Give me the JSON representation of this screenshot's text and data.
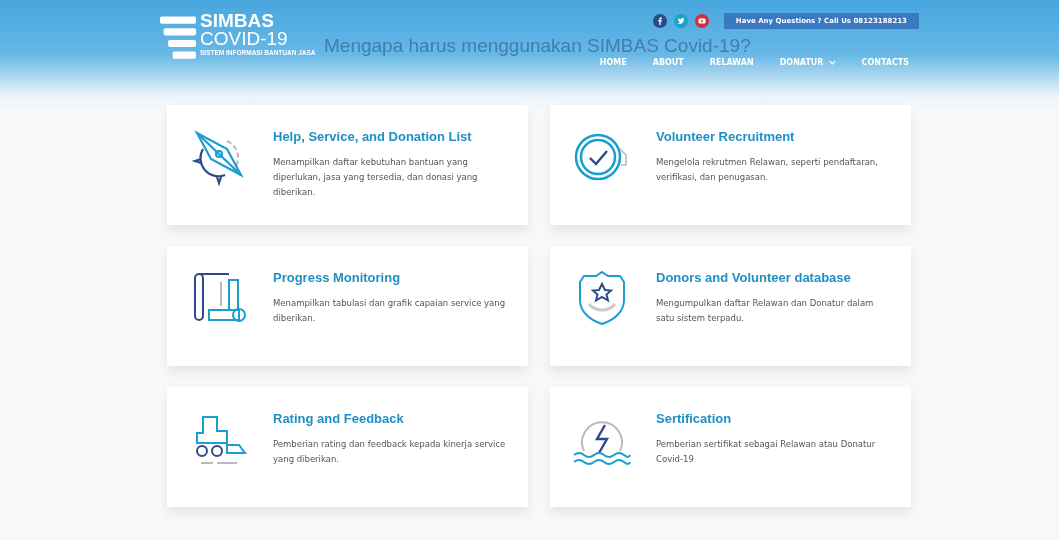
{
  "logo": {
    "line_1": "SIMBAS",
    "line_2": "COVID-19",
    "tagline": "SISTEM INFORMASI BANTUAN JASA"
  },
  "contact": "Have Any Questions ? Call Us 08123188213",
  "heading": "Mengapa harus menggunakan SIMBAS Covid-19?",
  "nav": [
    {
      "label": "HOME",
      "dropdown": false
    },
    {
      "label": "ABOUT",
      "dropdown": false
    },
    {
      "label": "RELAWAN",
      "dropdown": false
    },
    {
      "label": "DONATUR",
      "dropdown": true
    },
    {
      "label": "CONTACTS",
      "dropdown": false
    }
  ],
  "features": [
    {
      "title": "Help, Service, and Donation List",
      "text": "Menampilkan daftar kebutuhan bantuan yang diperlukan, jasa yang tersedia, dan donasi yang diberikan."
    },
    {
      "title": "Volunteer Recruitment",
      "text": "Mengelola rekrutmen Relawan, seperti pendaftaran, verifikasi, dan penugasan."
    },
    {
      "title": "Progress Monitoring",
      "text": "Menampilkan tabulasi dan grafik capaian service yang diberikan."
    },
    {
      "title": "Donors and Volunteer database",
      "text": "Mengumpulkan daftar Relawan dan Donatur dalam satu sistem terpadu."
    },
    {
      "title": "Rating and Feedback",
      "text": "Pemberian rating dan feedback kepada kinerja service yang diberikan."
    },
    {
      "title": "Sertification",
      "text": "Pemberian sertifikat sebagai Relawan atau Donatur Covid-19"
    }
  ]
}
